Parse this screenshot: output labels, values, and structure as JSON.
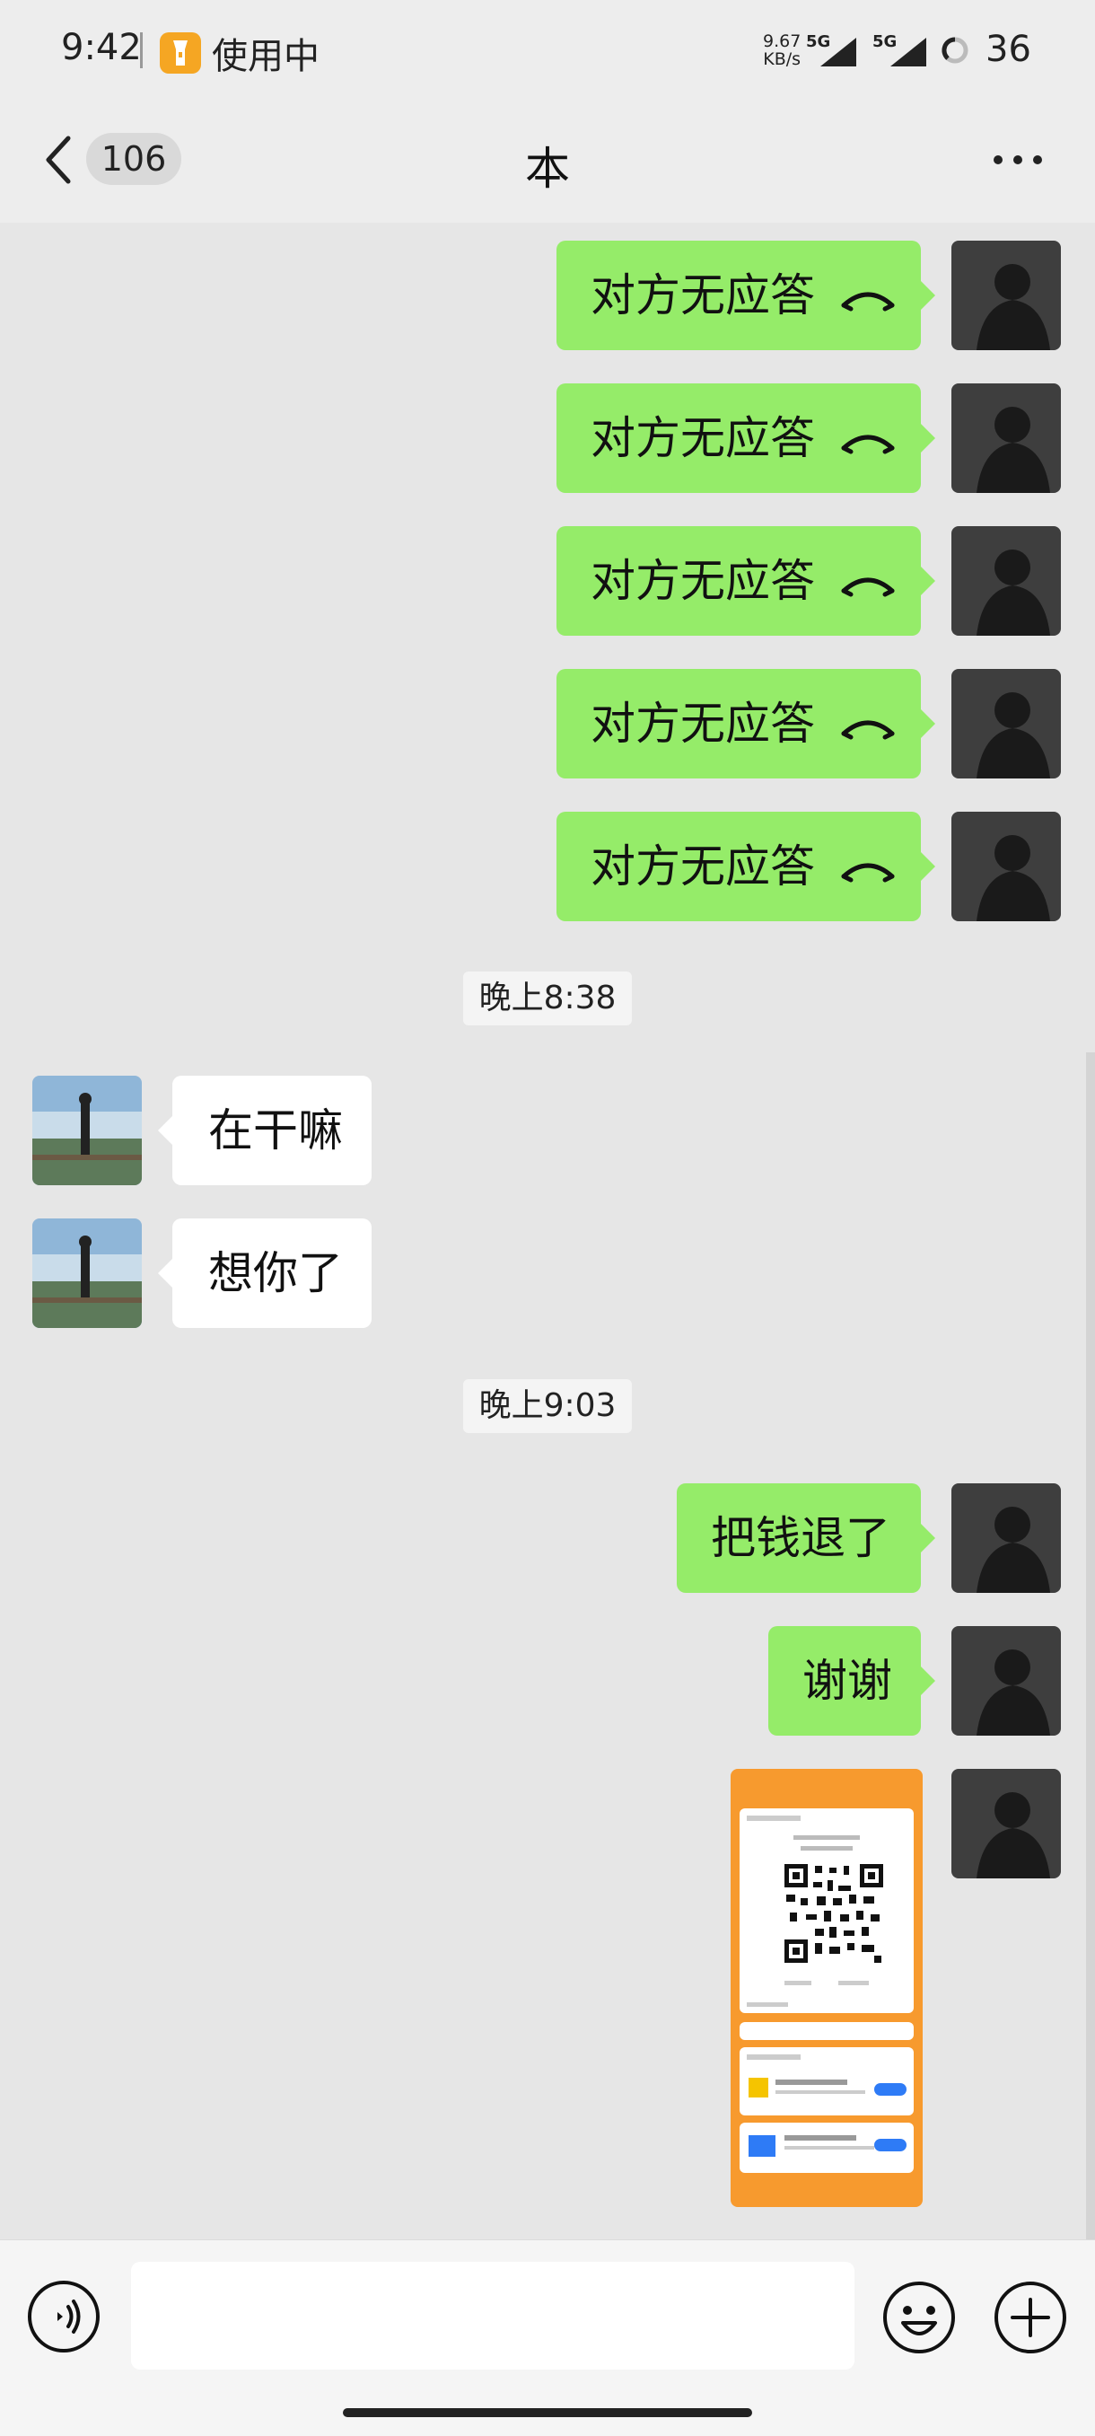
{
  "status_bar": {
    "time": "9:42",
    "app_in_use": "使用中",
    "net_speed_value": "9.67",
    "net_speed_unit": "KB/s",
    "signal1": "5G",
    "signal2": "5G",
    "battery": "36"
  },
  "header": {
    "unread_count": "106",
    "title": "本"
  },
  "messages": {
    "missed_call_text": "对方无应答",
    "time1": "晚上8:38",
    "incoming1": "在干嘛",
    "incoming2": "想你了",
    "time2": "晚上9:03",
    "outgoing1": "把钱退了",
    "outgoing2": "谢谢"
  },
  "colors": {
    "outgoing_bubble": "#95ec69",
    "incoming_bubble": "#ffffff",
    "chat_background": "#e6e6e6",
    "image_accent": "#f79a2e"
  },
  "icons": [
    "flashlight-icon",
    "back-chevron-icon",
    "more-icon",
    "phone-hangup-icon",
    "voice-icon",
    "emoji-icon",
    "plus-icon"
  ]
}
